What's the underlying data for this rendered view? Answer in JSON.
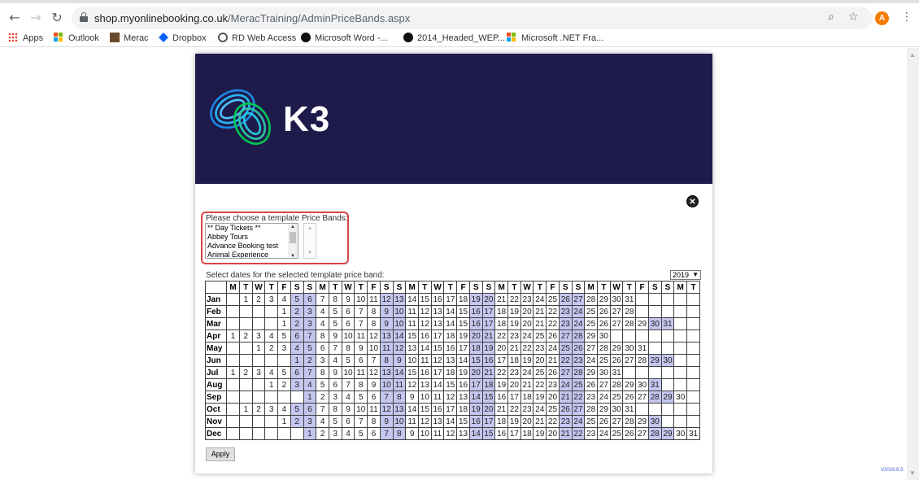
{
  "browser": {
    "url_host": "shop.myonlinebooking.co.uk",
    "url_path": "/MeracTraining/AdminPriceBands.aspx",
    "avatar_letter": "A",
    "bookmarks": [
      {
        "label": "Apps",
        "icon": "apps-grid-icon"
      },
      {
        "label": "Outlook",
        "icon": "microsoft-icon"
      },
      {
        "label": "Merac",
        "icon": "merac-icon"
      },
      {
        "label": "Dropbox",
        "icon": "dropbox-icon"
      },
      {
        "label": "RD Web Access",
        "icon": "globe-icon"
      },
      {
        "label": "Microsoft Word -...",
        "icon": "github-icon"
      },
      {
        "label": "2014_Headed_WEP...",
        "icon": "github-icon"
      },
      {
        "label": "Microsoft .NET Fra...",
        "icon": "microsoft-icon"
      }
    ]
  },
  "brand": {
    "logo_text": "K3",
    "banner_color": "#1e1b4b"
  },
  "form": {
    "band_label": "Please choose a template Price Bands:",
    "band_options": [
      "** Day Tickets **",
      "Abbey Tours",
      "Advance Booking test",
      "Animal Experience"
    ],
    "dates_label": "Select dates for the selected template price band:",
    "year": "2019",
    "apply_label": "Apply"
  },
  "calendar": {
    "weekday_headers": [
      "M",
      "T",
      "W",
      "T",
      "F",
      "S",
      "S",
      "M",
      "T",
      "W",
      "T",
      "F",
      "S",
      "S",
      "M",
      "T",
      "W",
      "T",
      "F",
      "S",
      "S",
      "M",
      "T",
      "W",
      "T",
      "F",
      "S",
      "S",
      "M",
      "T",
      "W",
      "T",
      "F",
      "S",
      "S",
      "M",
      "T"
    ],
    "months": [
      {
        "label": "Jan",
        "offset": 1,
        "days": 31
      },
      {
        "label": "Feb",
        "offset": 4,
        "days": 28
      },
      {
        "label": "Mar",
        "offset": 4,
        "days": 31
      },
      {
        "label": "Apr",
        "offset": 0,
        "days": 30
      },
      {
        "label": "May",
        "offset": 2,
        "days": 31
      },
      {
        "label": "Jun",
        "offset": 5,
        "days": 30
      },
      {
        "label": "Jul",
        "offset": 0,
        "days": 31
      },
      {
        "label": "Aug",
        "offset": 3,
        "days": 31
      },
      {
        "label": "Sep",
        "offset": 6,
        "days": 30
      },
      {
        "label": "Oct",
        "offset": 1,
        "days": 31
      },
      {
        "label": "Nov",
        "offset": 4,
        "days": 30
      },
      {
        "label": "Dec",
        "offset": 6,
        "days": 31
      }
    ],
    "weekend_color": "#c5c6f0"
  },
  "footer": {
    "version": "V2019.9.3"
  }
}
